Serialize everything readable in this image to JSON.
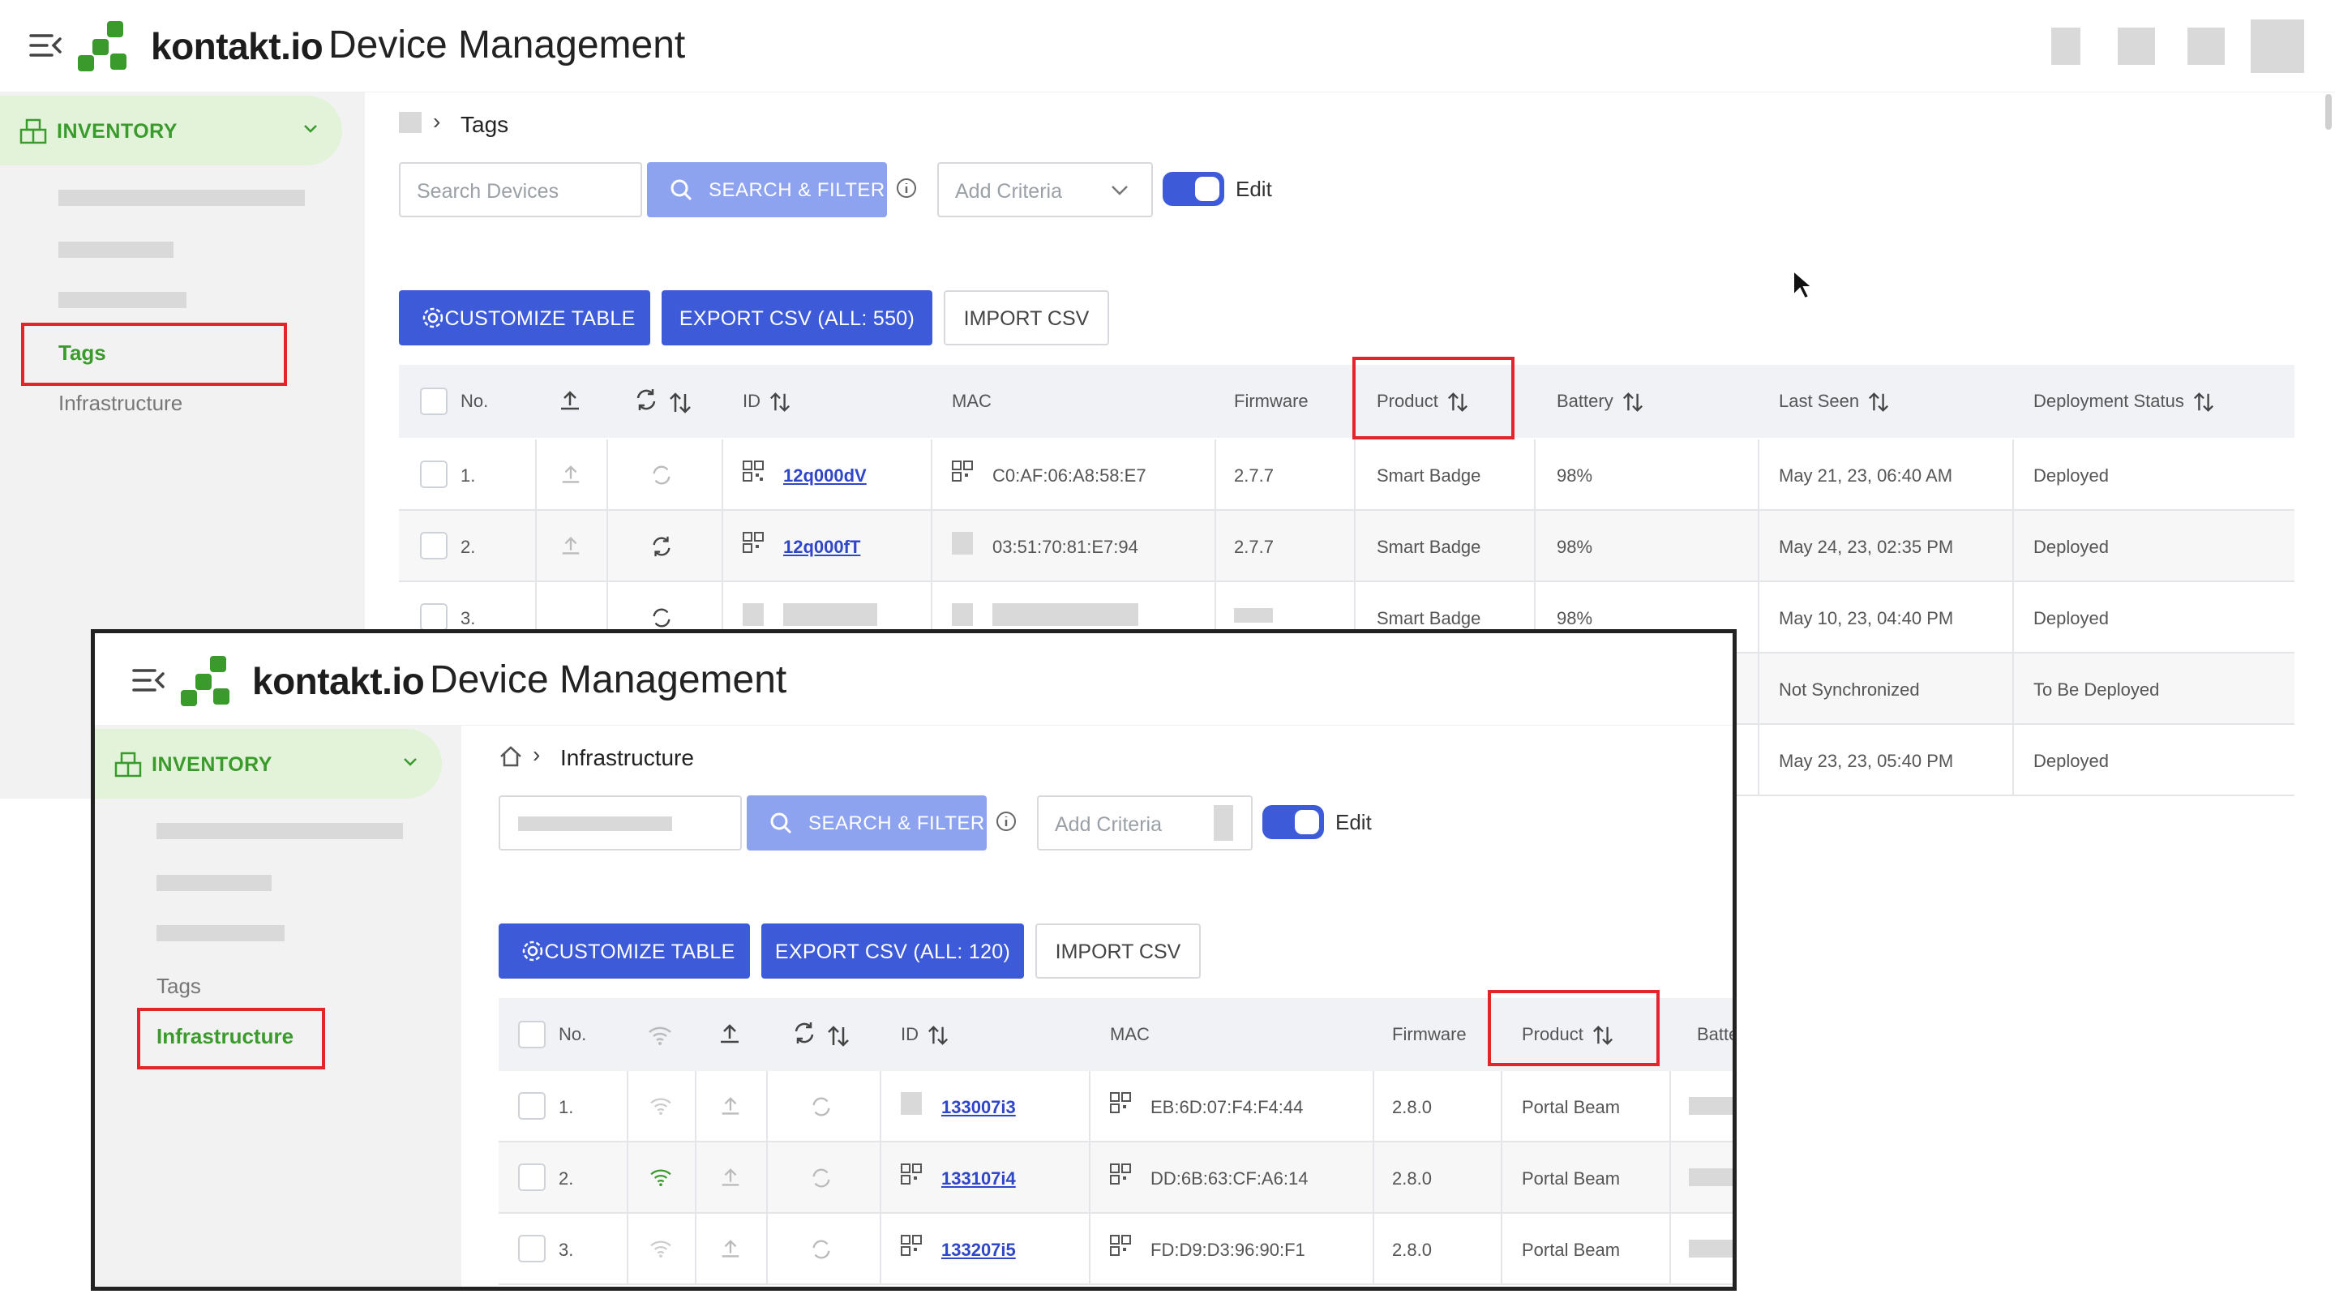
{
  "header": {
    "brand": "kontakt.io",
    "title": "Device Management"
  },
  "sidebar": {
    "inventory_label": "INVENTORY",
    "items": [
      "Tags",
      "Infrastructure"
    ]
  },
  "colors": {
    "accent_blue": "#3d5bd9",
    "search_button": "#8ea3ef",
    "brand_green": "#3a9b2c",
    "highlight_red": "#e3242b"
  },
  "back": {
    "breadcrumb": "Tags",
    "search_placeholder": "Search Devices",
    "search_button": "SEARCH & FILTER",
    "criteria_placeholder": "Add Criteria",
    "edit_label": "Edit",
    "customize_button": "CUSTOMIZE TABLE",
    "export_button": "EXPORT CSV (ALL: 550)",
    "import_button": "IMPORT CSV",
    "columns": [
      "No.",
      "ID",
      "MAC",
      "Firmware",
      "Product",
      "Battery",
      "Last Seen",
      "Deployment Status"
    ],
    "rows": [
      {
        "no": "1.",
        "id": "12q000dV",
        "mac": "C0:AF:06:A8:58:E7",
        "firmware": "2.7.7",
        "product": "Smart Badge",
        "battery": "98%",
        "last_seen": "May 21, 23, 06:40 AM",
        "status": "Deployed"
      },
      {
        "no": "2.",
        "id": "12q000fT",
        "mac": "03:51:70:81:E7:94",
        "firmware": "2.7.7",
        "product": "Smart Badge",
        "battery": "98%",
        "last_seen": "May 24, 23, 02:35 PM",
        "status": "Deployed"
      },
      {
        "no": "3.",
        "id": "",
        "mac": "",
        "firmware": "",
        "product": "Smart Badge",
        "battery": "98%",
        "last_seen": "May 10, 23, 04:40 PM",
        "status": "Deployed"
      },
      {
        "no": "",
        "id": "",
        "mac": "",
        "firmware": "",
        "product": "",
        "battery": "",
        "last_seen": "Not Synchronized",
        "status": "To Be Deployed"
      },
      {
        "no": "",
        "id": "",
        "mac": "",
        "firmware": "",
        "product": "",
        "battery": "",
        "last_seen": "May 23, 23, 05:40 PM",
        "status": "Deployed"
      }
    ]
  },
  "front": {
    "breadcrumb": "Infrastructure",
    "search_button": "SEARCH & FILTER",
    "criteria_placeholder": "Add Criteria",
    "edit_label": "Edit",
    "customize_button": "CUSTOMIZE TABLE",
    "export_button": "EXPORT CSV (ALL: 120)",
    "import_button": "IMPORT CSV",
    "columns": [
      "No.",
      "ID",
      "MAC",
      "Firmware",
      "Product",
      "Batter"
    ],
    "rows": [
      {
        "no": "1.",
        "id": "133007i3",
        "mac": "EB:6D:07:F4:F4:44",
        "firmware": "2.8.0",
        "product": "Portal Beam"
      },
      {
        "no": "2.",
        "id": "133107i4",
        "mac": "DD:6B:63:CF:A6:14",
        "firmware": "2.8.0",
        "product": "Portal Beam"
      },
      {
        "no": "3.",
        "id": "133207i5",
        "mac": "FD:D9:D3:96:90:F1",
        "firmware": "2.8.0",
        "product": "Portal Beam"
      }
    ]
  }
}
